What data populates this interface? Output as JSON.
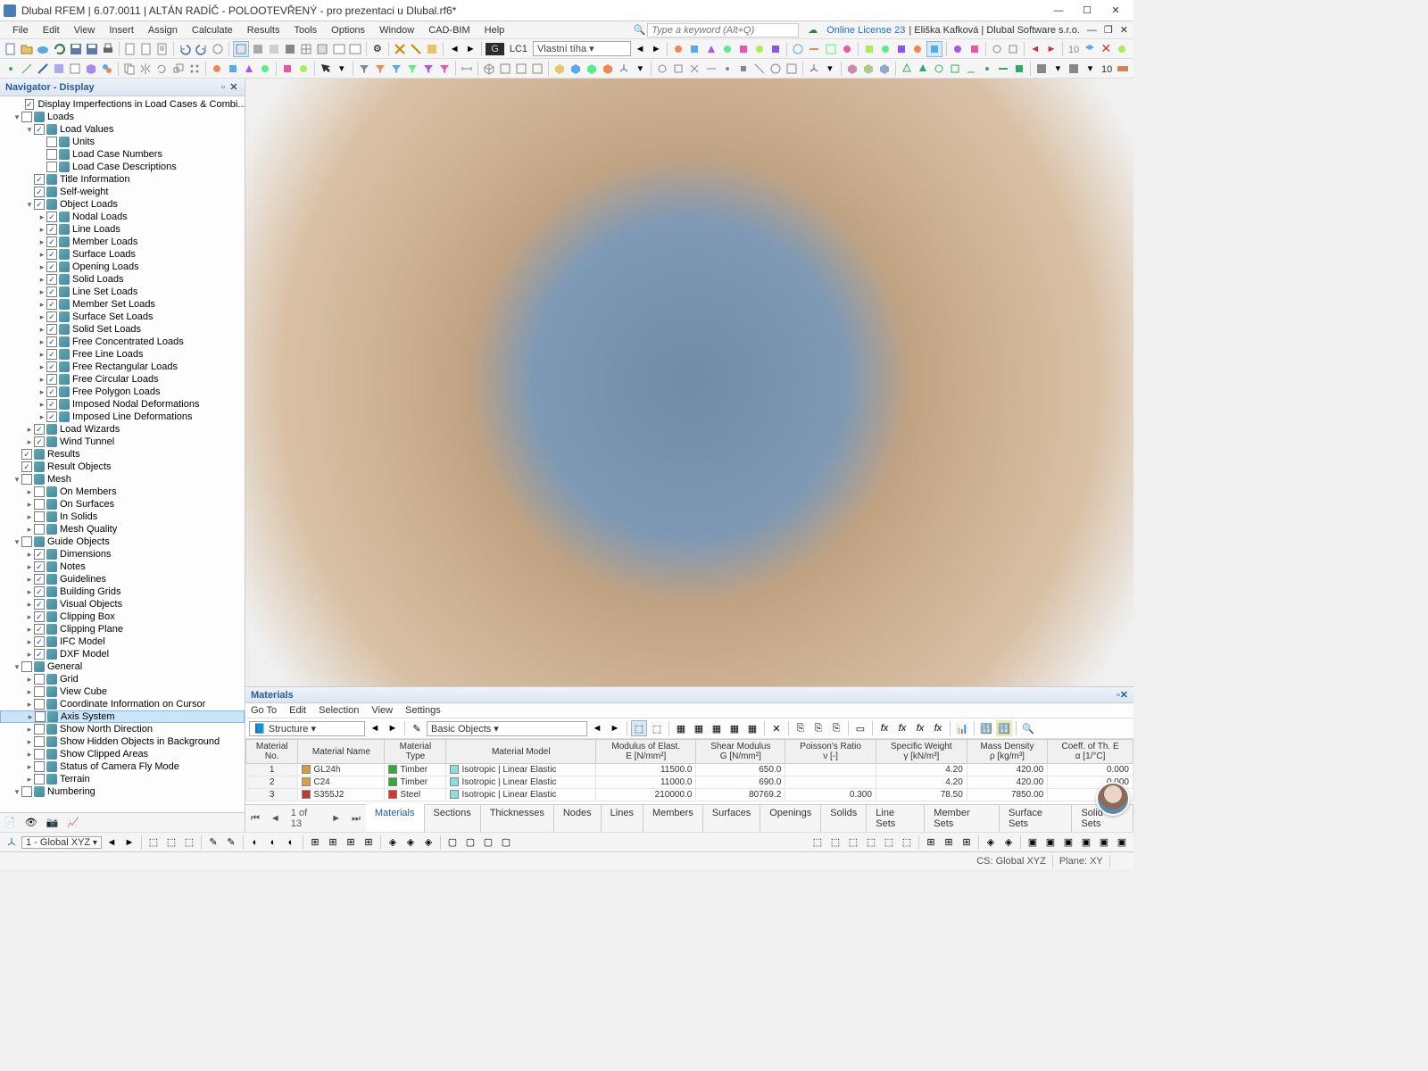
{
  "title": "Dlubal RFEM | 6.07.0011 | ALTÁN RADÍČ - POLOOTEVŘENÝ - pro prezentaci u Dlubal.rf6*",
  "menu": [
    "File",
    "Edit",
    "View",
    "Insert",
    "Assign",
    "Calculate",
    "Results",
    "Tools",
    "Options",
    "Window",
    "CAD-BIM",
    "Help"
  ],
  "search_placeholder": "Type a keyword (Alt+Q)",
  "license": "Online License 23",
  "user": "Eliška Kafková | Dlubal Software s.r.o.",
  "lc_tag": "G",
  "lc_code": "LC1",
  "lc_name": "Vlastní tíha",
  "nav_title": "Navigator - Display",
  "tree": [
    {
      "d": 2,
      "cb": 1,
      "exp": "",
      "label": "Display Imperfections in Load Cases & Combi..."
    },
    {
      "d": 1,
      "cb": 0,
      "exp": "v",
      "label": "Loads"
    },
    {
      "d": 2,
      "cb": 1,
      "exp": "v",
      "label": "Load Values"
    },
    {
      "d": 3,
      "cb": 0,
      "exp": "",
      "label": "Units"
    },
    {
      "d": 3,
      "cb": 0,
      "exp": "",
      "label": "Load Case Numbers"
    },
    {
      "d": 3,
      "cb": 0,
      "exp": "",
      "label": "Load Case Descriptions"
    },
    {
      "d": 2,
      "cb": 1,
      "exp": "",
      "label": "Title Information"
    },
    {
      "d": 2,
      "cb": 1,
      "exp": "",
      "label": "Self-weight"
    },
    {
      "d": 2,
      "cb": 1,
      "exp": "v",
      "label": "Object Loads"
    },
    {
      "d": 3,
      "cb": 1,
      "exp": ">",
      "label": "Nodal Loads"
    },
    {
      "d": 3,
      "cb": 1,
      "exp": ">",
      "label": "Line Loads"
    },
    {
      "d": 3,
      "cb": 1,
      "exp": ">",
      "label": "Member Loads"
    },
    {
      "d": 3,
      "cb": 1,
      "exp": ">",
      "label": "Surface Loads"
    },
    {
      "d": 3,
      "cb": 1,
      "exp": ">",
      "label": "Opening Loads"
    },
    {
      "d": 3,
      "cb": 1,
      "exp": ">",
      "label": "Solid Loads"
    },
    {
      "d": 3,
      "cb": 1,
      "exp": ">",
      "label": "Line Set Loads"
    },
    {
      "d": 3,
      "cb": 1,
      "exp": ">",
      "label": "Member Set Loads"
    },
    {
      "d": 3,
      "cb": 1,
      "exp": ">",
      "label": "Surface Set Loads"
    },
    {
      "d": 3,
      "cb": 1,
      "exp": ">",
      "label": "Solid Set Loads"
    },
    {
      "d": 3,
      "cb": 1,
      "exp": ">",
      "label": "Free Concentrated Loads"
    },
    {
      "d": 3,
      "cb": 1,
      "exp": ">",
      "label": "Free Line Loads"
    },
    {
      "d": 3,
      "cb": 1,
      "exp": ">",
      "label": "Free Rectangular Loads"
    },
    {
      "d": 3,
      "cb": 1,
      "exp": ">",
      "label": "Free Circular Loads"
    },
    {
      "d": 3,
      "cb": 1,
      "exp": ">",
      "label": "Free Polygon Loads"
    },
    {
      "d": 3,
      "cb": 1,
      "exp": ">",
      "label": "Imposed Nodal Deformations"
    },
    {
      "d": 3,
      "cb": 1,
      "exp": ">",
      "label": "Imposed Line Deformations"
    },
    {
      "d": 2,
      "cb": 1,
      "exp": ">",
      "label": "Load Wizards"
    },
    {
      "d": 2,
      "cb": 1,
      "exp": ">",
      "label": "Wind Tunnel"
    },
    {
      "d": 1,
      "cb": 1,
      "exp": "",
      "label": "Results"
    },
    {
      "d": 1,
      "cb": 1,
      "exp": "",
      "label": "Result Objects"
    },
    {
      "d": 1,
      "cb": 0,
      "exp": "v",
      "label": "Mesh"
    },
    {
      "d": 2,
      "cb": 0,
      "exp": ">",
      "label": "On Members"
    },
    {
      "d": 2,
      "cb": 0,
      "exp": ">",
      "label": "On Surfaces"
    },
    {
      "d": 2,
      "cb": 0,
      "exp": ">",
      "label": "In Solids"
    },
    {
      "d": 2,
      "cb": 0,
      "exp": ">",
      "label": "Mesh Quality"
    },
    {
      "d": 1,
      "cb": 0,
      "exp": "v",
      "label": "Guide Objects"
    },
    {
      "d": 2,
      "cb": 1,
      "exp": ">",
      "label": "Dimensions"
    },
    {
      "d": 2,
      "cb": 1,
      "exp": ">",
      "label": "Notes"
    },
    {
      "d": 2,
      "cb": 1,
      "exp": ">",
      "label": "Guidelines"
    },
    {
      "d": 2,
      "cb": 1,
      "exp": ">",
      "label": "Building Grids"
    },
    {
      "d": 2,
      "cb": 1,
      "exp": ">",
      "label": "Visual Objects"
    },
    {
      "d": 2,
      "cb": 1,
      "exp": ">",
      "label": "Clipping Box"
    },
    {
      "d": 2,
      "cb": 1,
      "exp": ">",
      "label": "Clipping Plane"
    },
    {
      "d": 2,
      "cb": 1,
      "exp": ">",
      "label": "IFC Model"
    },
    {
      "d": 2,
      "cb": 1,
      "exp": ">",
      "label": "DXF Model"
    },
    {
      "d": 1,
      "cb": 0,
      "exp": "v",
      "label": "General"
    },
    {
      "d": 2,
      "cb": 0,
      "exp": ">",
      "label": "Grid"
    },
    {
      "d": 2,
      "cb": 0,
      "exp": ">",
      "label": "View Cube"
    },
    {
      "d": 2,
      "cb": 0,
      "exp": ">",
      "label": "Coordinate Information on Cursor"
    },
    {
      "d": 2,
      "cb": 0,
      "exp": ">",
      "label": "Axis System",
      "sel": true
    },
    {
      "d": 2,
      "cb": 0,
      "exp": ">",
      "label": "Show North Direction"
    },
    {
      "d": 2,
      "cb": 0,
      "exp": ">",
      "label": "Show Hidden Objects in Background"
    },
    {
      "d": 2,
      "cb": 0,
      "exp": ">",
      "label": "Show Clipped Areas"
    },
    {
      "d": 2,
      "cb": 0,
      "exp": ">",
      "label": "Status of Camera Fly Mode"
    },
    {
      "d": 2,
      "cb": 0,
      "exp": ">",
      "label": "Terrain"
    },
    {
      "d": 1,
      "cb": 0,
      "exp": "v",
      "label": "Numbering"
    }
  ],
  "materials": {
    "title": "Materials",
    "menu": [
      "Go To",
      "Edit",
      "Selection",
      "View",
      "Settings"
    ],
    "combo1": "Structure",
    "combo2": "Basic Objects",
    "headers_top": [
      "Material\nNo.",
      "Material Name",
      "Material\nType",
      "Material Model",
      "Modulus of Elast.\nE [N/mm²]",
      "Shear Modulus\nG [N/mm²]",
      "Poisson's Ratio\nν [-]",
      "Specific Weight\nγ [kN/m³]",
      "Mass Density\nρ [kg/m³]",
      "Coeff. of Th. E\nα [1/°C]"
    ],
    "rows": [
      {
        "no": "1",
        "name": "GL24h",
        "color": "#d59b44",
        "type": "Timber",
        "model": "Isotropic | Linear Elastic",
        "E": "11500.0",
        "G": "650.0",
        "nu": "",
        "gw": "4.20",
        "rho": "420.00",
        "a": "0.000"
      },
      {
        "no": "2",
        "name": "C24",
        "color": "#d5a144",
        "type": "Timber",
        "model": "Isotropic | Linear Elastic",
        "E": "11000.0",
        "G": "690.0",
        "nu": "",
        "gw": "4.20",
        "rho": "420.00",
        "a": "0.000"
      },
      {
        "no": "3",
        "name": "S355J2",
        "color": "#c13838",
        "type": "Steel",
        "model": "Isotropic | Linear Elastic",
        "E": "210000.0",
        "G": "80769.2",
        "nu": "0.300",
        "gw": "78.50",
        "rho": "7850.00",
        "a": "0.000"
      }
    ],
    "nav": "1 of 13",
    "tabs": [
      "Materials",
      "Sections",
      "Thicknesses",
      "Nodes",
      "Lines",
      "Members",
      "Surfaces",
      "Openings",
      "Solids",
      "Line Sets",
      "Member Sets",
      "Surface Sets",
      "Solid Sets"
    ]
  },
  "status": {
    "cs_combo": "1 - Global XYZ",
    "cs": "CS: Global XYZ",
    "plane": "Plane: XY"
  }
}
